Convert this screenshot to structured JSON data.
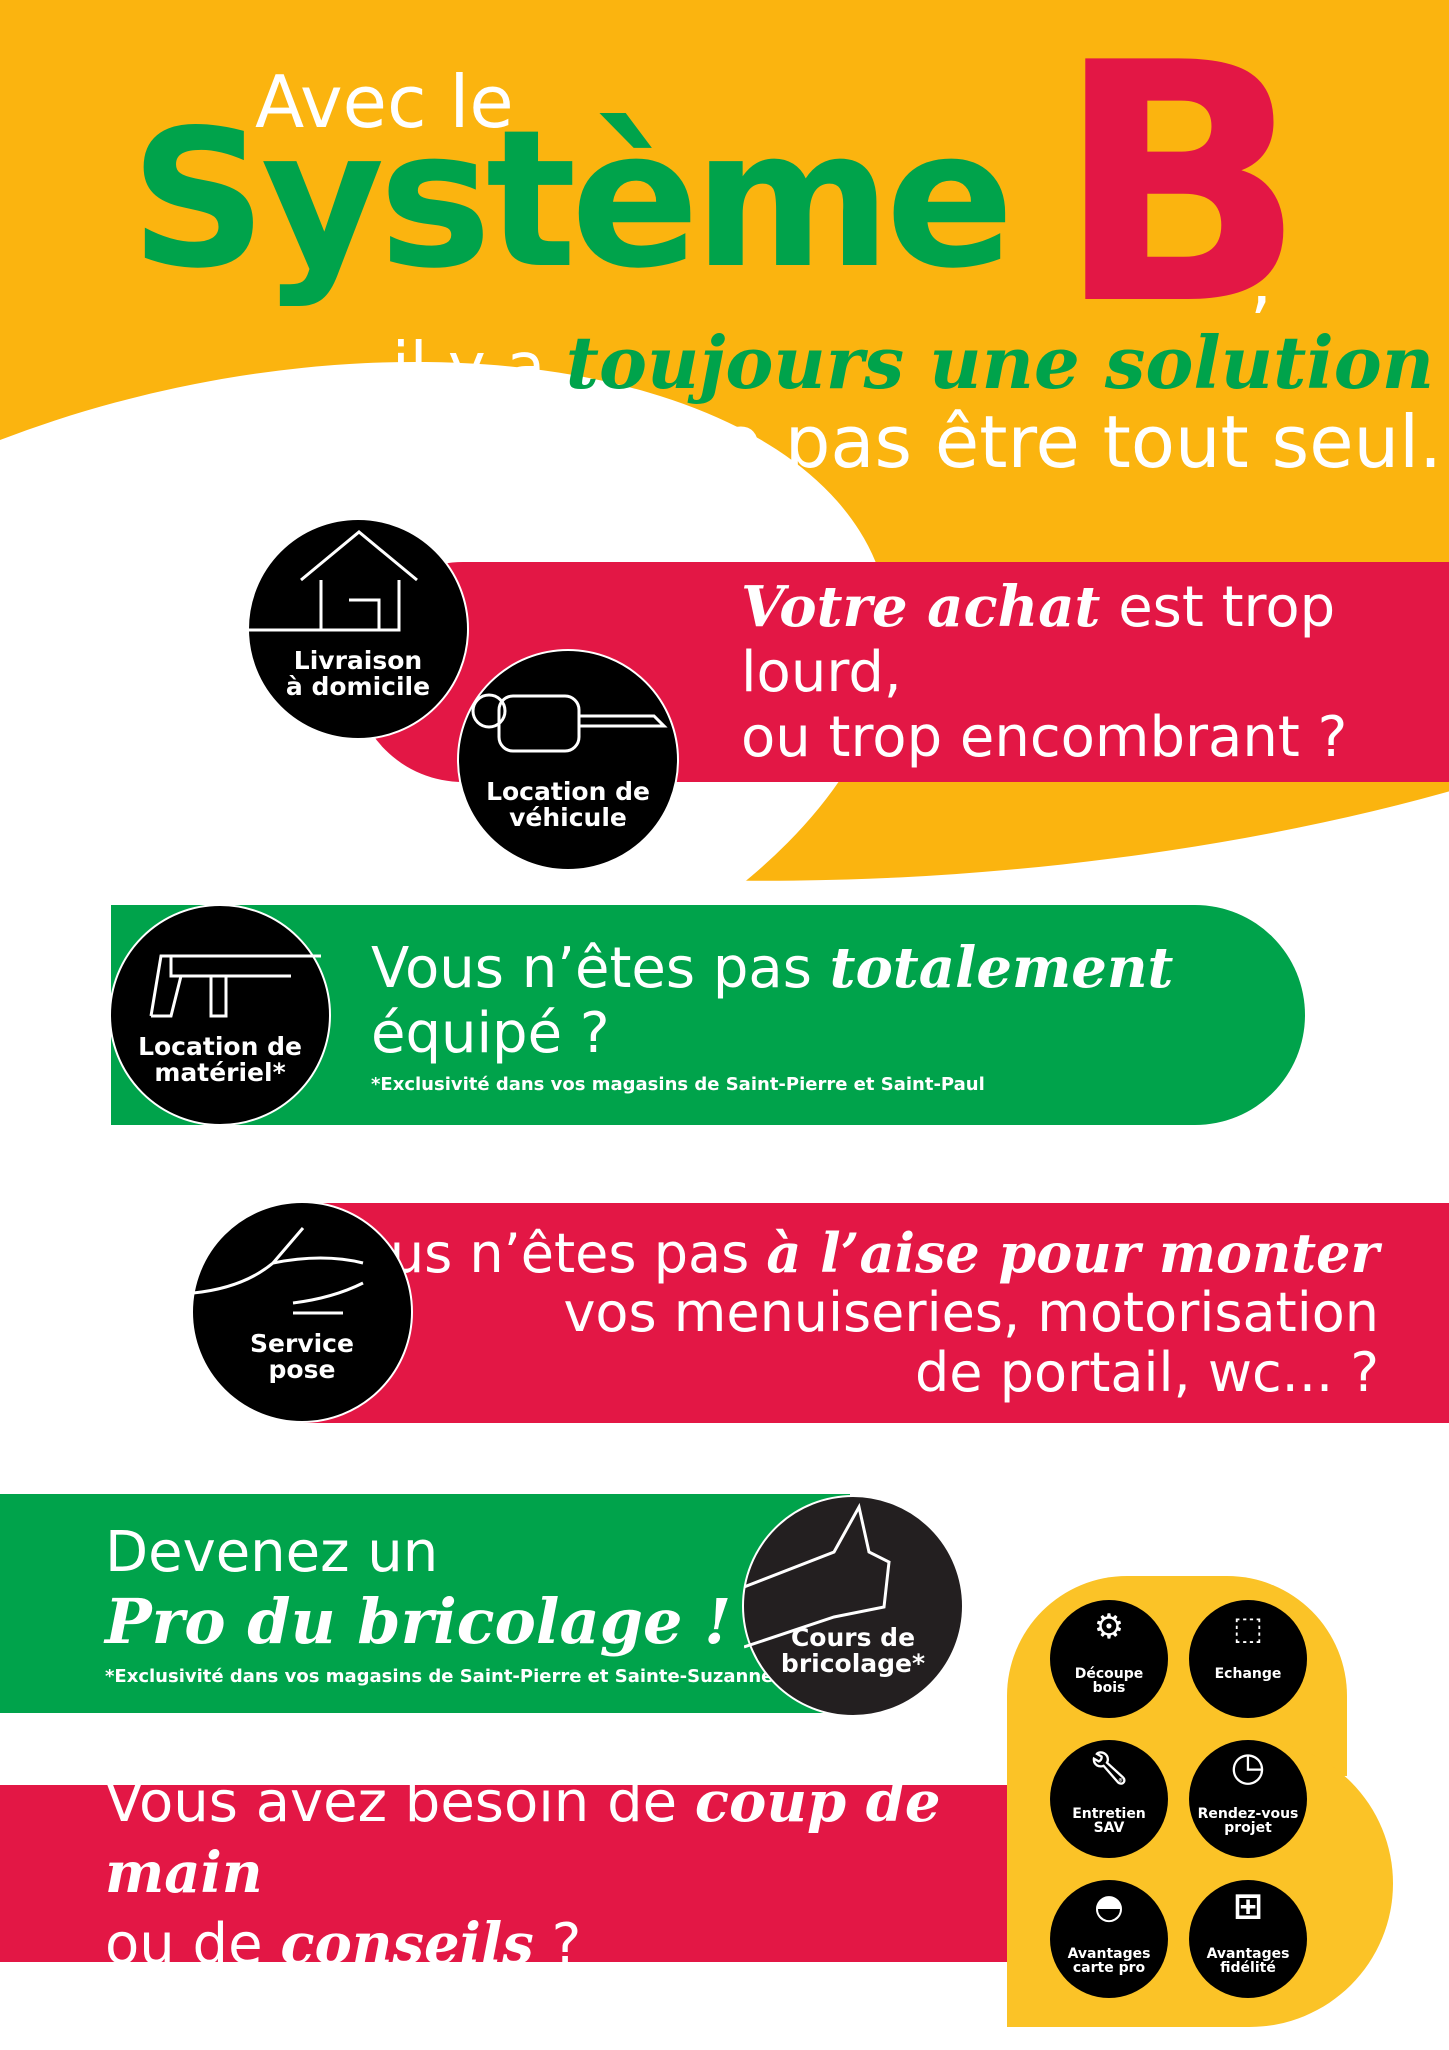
{
  "header": {
    "line1": "Avec le",
    "brand": "Système",
    "brand_letter": "B",
    "comma": ",",
    "line3_prefix": "il y a",
    "line3_script": "toujours une solution",
    "line4": "pour ne pas être tout seul."
  },
  "sections": [
    {
      "script": "Votre achat",
      "text1": " est trop lourd,",
      "text2": "ou trop encombrant ?",
      "services": [
        {
          "label1": "Livraison",
          "label2": "à domicile",
          "icon": "house-icon"
        },
        {
          "label1": "Location de",
          "label2": "véhicule",
          "icon": "car-key-icon"
        }
      ]
    },
    {
      "text1": "Vous n’êtes pas ",
      "script": "totalement",
      "text2": " équipé ?",
      "note": "*Exclusivité dans vos magasins de Saint-Pierre et Saint-Paul",
      "service": {
        "label1": "Location de",
        "label2": "matériel*",
        "icon": "drill-icon"
      }
    },
    {
      "text1": "Vous n’êtes pas ",
      "script": "à l’aise pour monter",
      "text2": "vos menuiseries, motorisation",
      "text3": "de portail, wc... ?",
      "service": {
        "label1": "Service",
        "label2": "pose",
        "icon": "hand-icon"
      }
    },
    {
      "text1": "Devenez un",
      "script": "Pro du bricolage !",
      "note": "*Exclusivité dans vos magasins de Saint-Pierre et Sainte-Suzanne",
      "service": {
        "label1": "Cours de",
        "label2": "bricolage*",
        "icon": "thumbs-up-icon"
      }
    },
    {
      "text1": "Vous avez besoin de ",
      "script1": "coup de main",
      "text2": "ou de ",
      "script2": "conseils",
      "text3": " ?"
    }
  ],
  "extras": [
    {
      "label1": "Découpe",
      "label2": "bois",
      "icon": "saw-blade-icon"
    },
    {
      "label1": "Echange",
      "label2": "",
      "icon": "box-icon"
    },
    {
      "label1": "Entretien",
      "label2": "SAV",
      "icon": "wrench-icon"
    },
    {
      "label1": "Rendez-vous",
      "label2": "projet",
      "icon": "clock-icon"
    },
    {
      "label1": "Avantages",
      "label2": "carte pro",
      "icon": "helmet-icon"
    },
    {
      "label1": "Avantages",
      "label2": "fidélité",
      "icon": "gift-icon"
    }
  ],
  "colors": {
    "yellow": "#fbb40f",
    "red": "#e31745",
    "green": "#00a34b",
    "black": "#000000"
  }
}
